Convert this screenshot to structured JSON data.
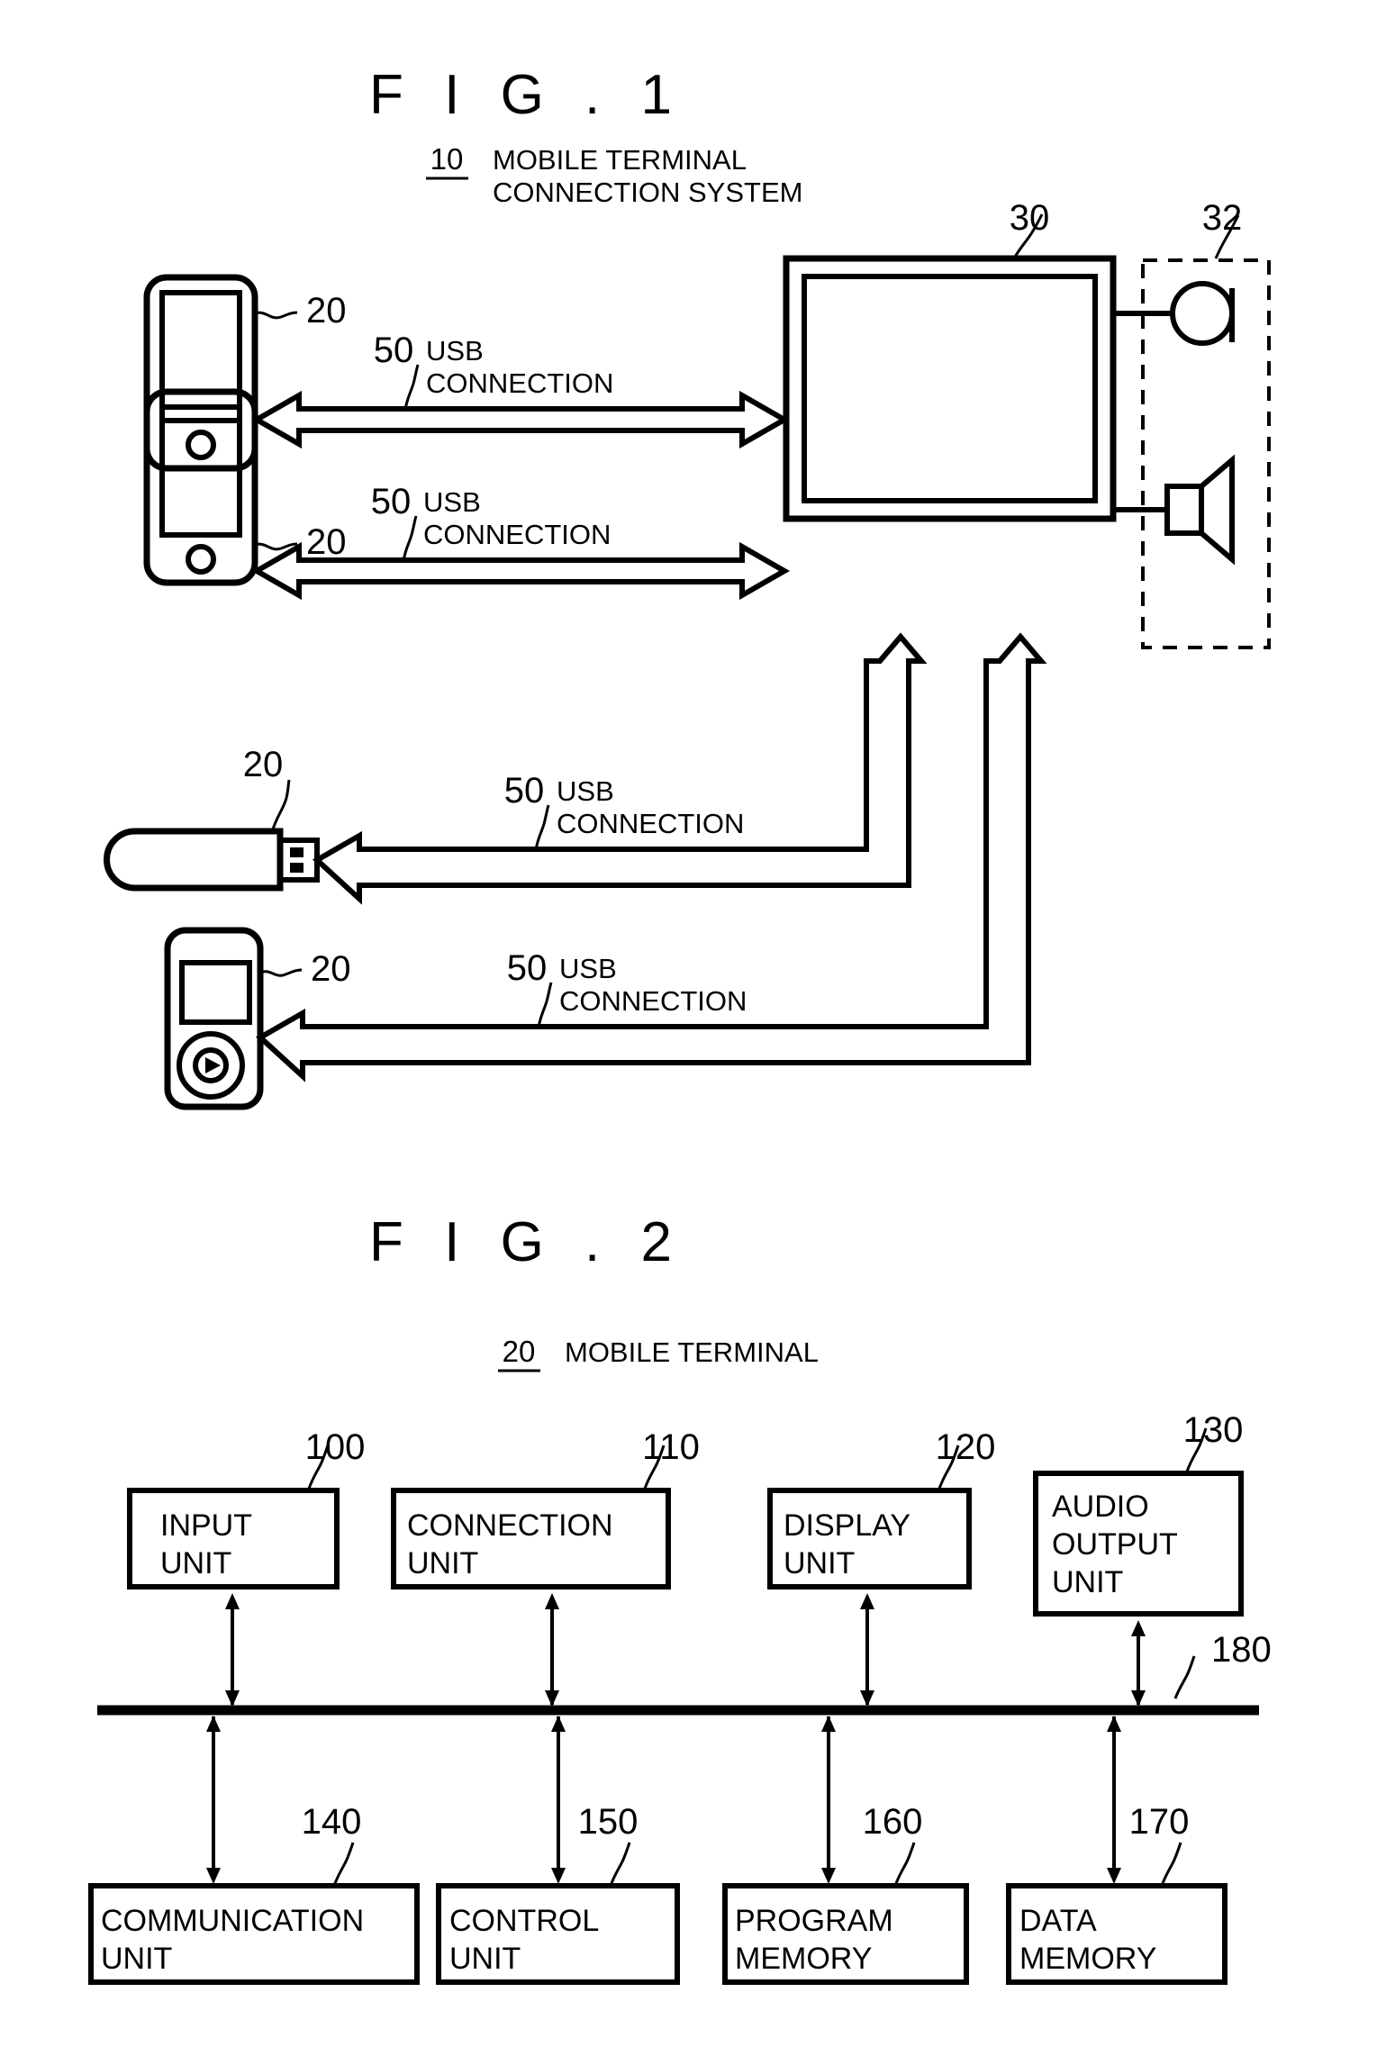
{
  "figures": [
    {
      "title": "F I G . 1",
      "header": {
        "num": "10",
        "line1": "MOBILE TERMINAL",
        "line2": "CONNECTION SYSTEM"
      },
      "labels": {
        "phone1": "20",
        "phone2": "20",
        "usbstick": "20",
        "player": "20",
        "main_unit": "30",
        "audio_group": "32"
      },
      "connections": [
        {
          "num": "50",
          "line1": "USB",
          "line2": "CONNECTION",
          "kind": "bidirectional"
        },
        {
          "num": "50",
          "line1": "USB",
          "line2": "CONNECTION",
          "kind": "bidirectional"
        },
        {
          "num": "50",
          "line1": "USB",
          "line2": "CONNECTION",
          "kind": "unidirectional"
        },
        {
          "num": "50",
          "line1": "USB",
          "line2": "CONNECTION",
          "kind": "unidirectional"
        }
      ]
    },
    {
      "title": "F I G . 2",
      "header": {
        "num": "20",
        "line1": "MOBILE TERMINAL",
        "line2": ""
      },
      "bus_label": "180",
      "top_blocks": [
        {
          "num": "100",
          "lines": [
            "INPUT",
            "UNIT"
          ]
        },
        {
          "num": "110",
          "lines": [
            "CONNECTION",
            "UNIT"
          ]
        },
        {
          "num": "120",
          "lines": [
            "DISPLAY",
            "UNIT"
          ]
        },
        {
          "num": "130",
          "lines": [
            "AUDIO",
            "OUTPUT",
            "UNIT"
          ]
        }
      ],
      "bottom_blocks": [
        {
          "num": "140",
          "lines": [
            "COMMUNICATION",
            "UNIT"
          ]
        },
        {
          "num": "150",
          "lines": [
            "CONTROL",
            "UNIT"
          ]
        },
        {
          "num": "160",
          "lines": [
            "PROGRAM",
            "MEMORY"
          ]
        },
        {
          "num": "170",
          "lines": [
            "DATA",
            "MEMORY"
          ]
        }
      ]
    }
  ],
  "colors": {
    "ink": "#000000",
    "paper": "#ffffff"
  }
}
